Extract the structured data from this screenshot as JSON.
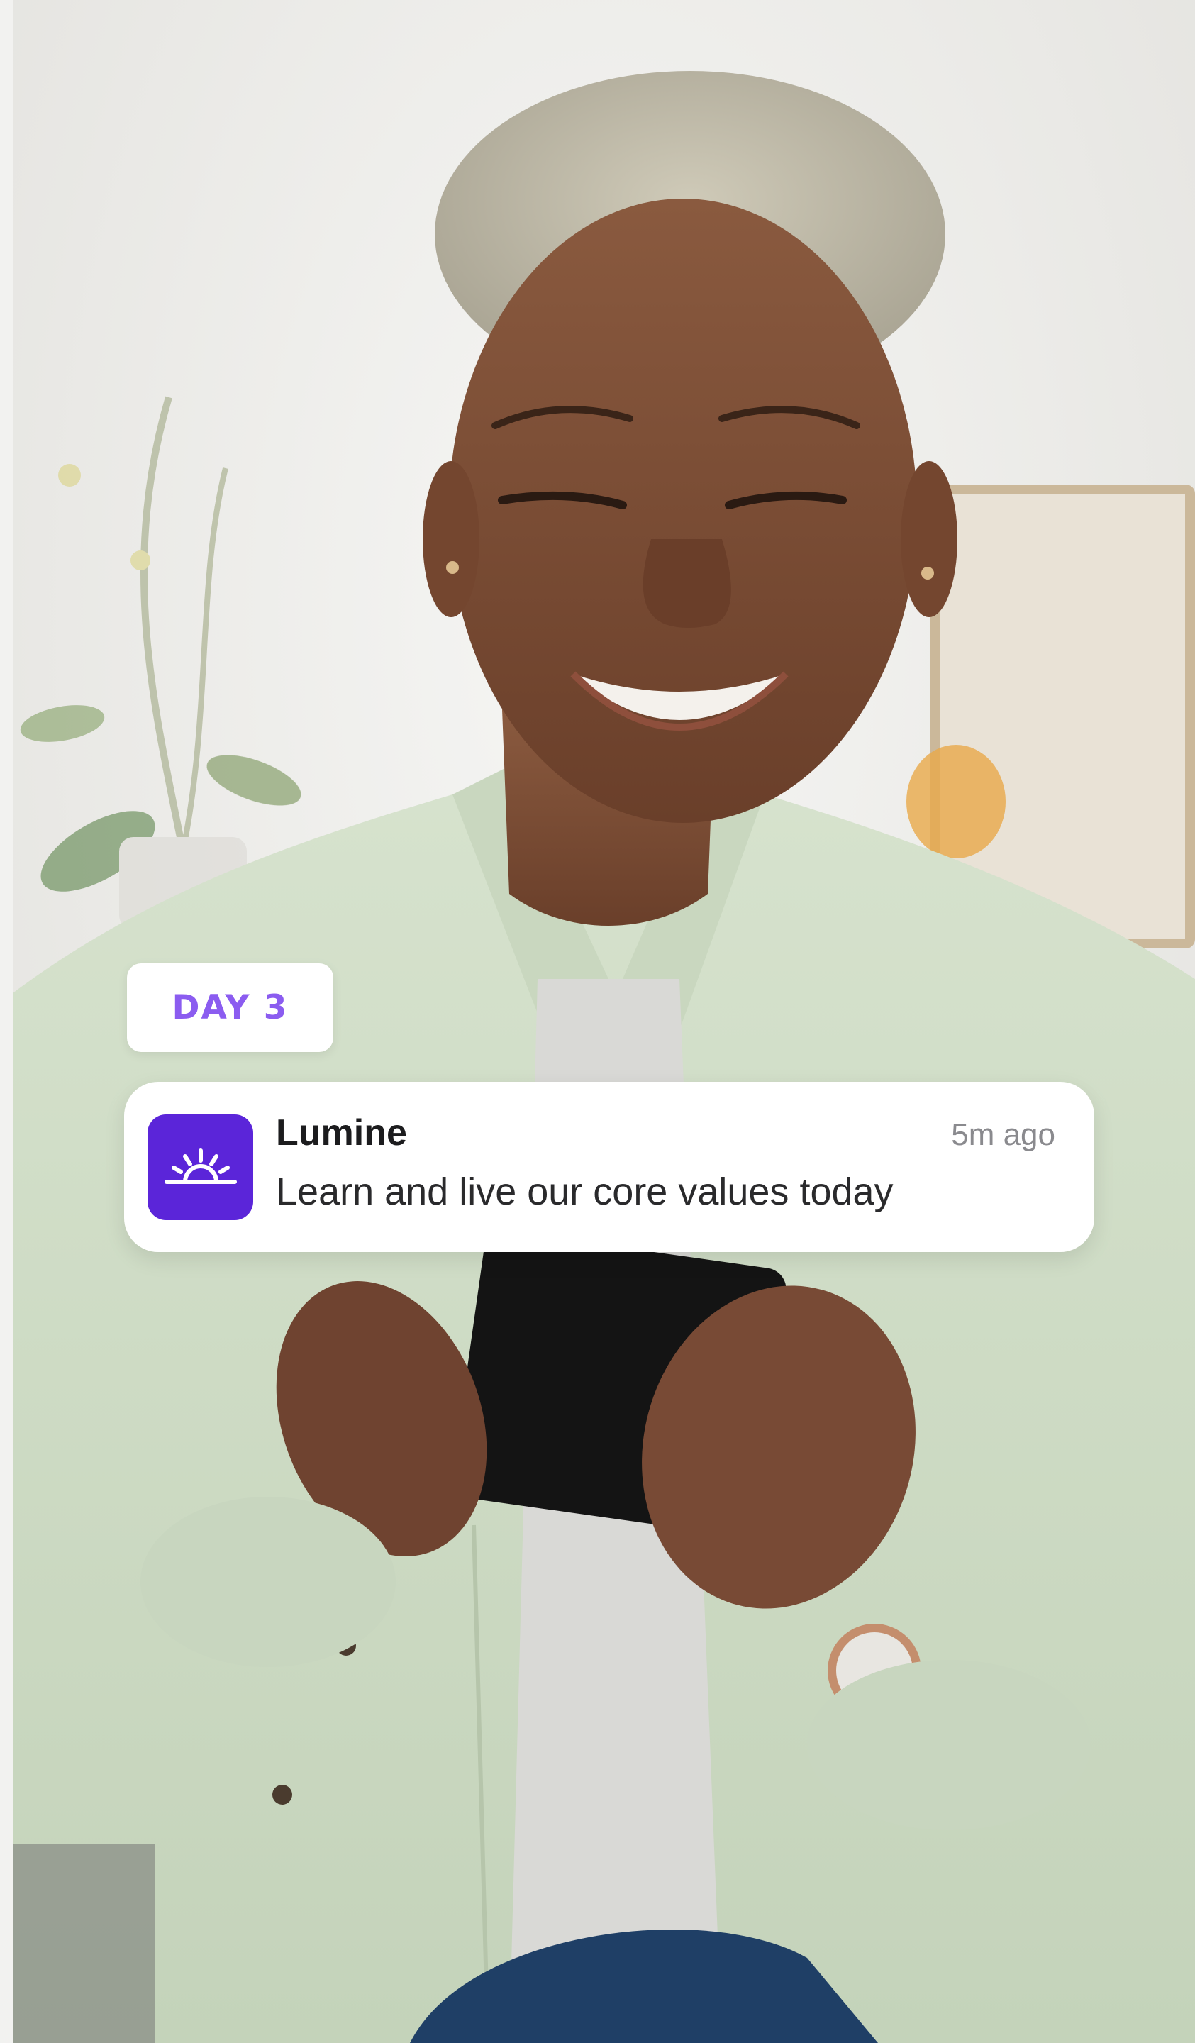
{
  "badge": {
    "label": "DAY 3",
    "color": "#8b5cf0"
  },
  "notification": {
    "app_name": "Lumine",
    "timestamp": "5m ago",
    "message": "Learn and live our core values today",
    "icon": "sunrise-icon",
    "icon_bg": "#5b25d9"
  },
  "background": {
    "shirt_color": "#cfdcc6",
    "wall_color": "#efefed"
  }
}
